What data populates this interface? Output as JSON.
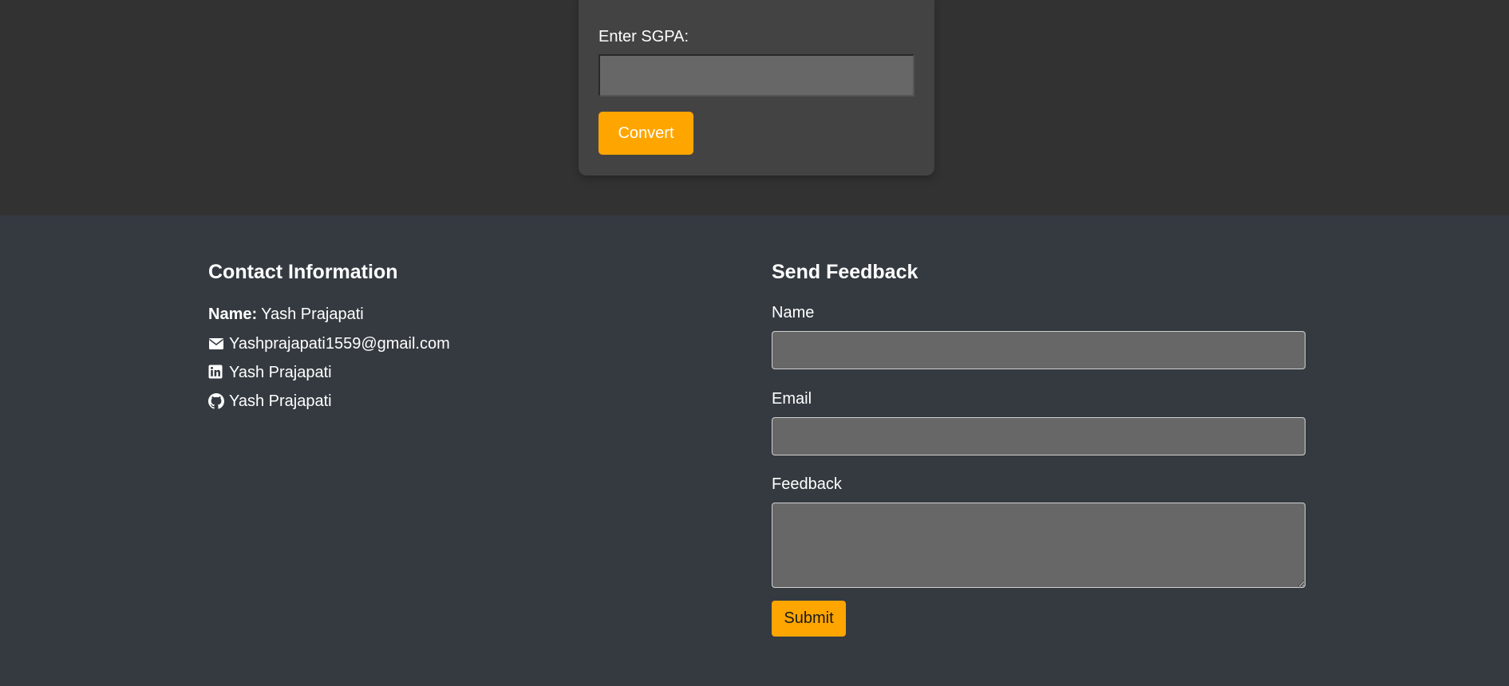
{
  "converter": {
    "sgpa_label": "Enter SGPA:",
    "sgpa_value": "",
    "convert_label": "Convert"
  },
  "contact": {
    "heading": "Contact Information",
    "name_label": "Name:",
    "name_value": "Yash Prajapati",
    "email": "Yashprajapati1559@gmail.com",
    "linkedin": "Yash Prajapati",
    "github": "Yash Prajapati",
    "icons": [
      "envelope-icon",
      "linkedin-icon",
      "github-icon"
    ]
  },
  "feedback": {
    "heading": "Send Feedback",
    "name_label": "Name",
    "name_value": "",
    "email_label": "Email",
    "email_value": "",
    "feedback_label": "Feedback",
    "feedback_value": "",
    "submit_label": "Submit"
  },
  "colors": {
    "accent": "#ffa500",
    "page_bg": "#323232",
    "card_bg": "#434343",
    "footer_bg": "#343a40",
    "input_bg": "#676767"
  }
}
